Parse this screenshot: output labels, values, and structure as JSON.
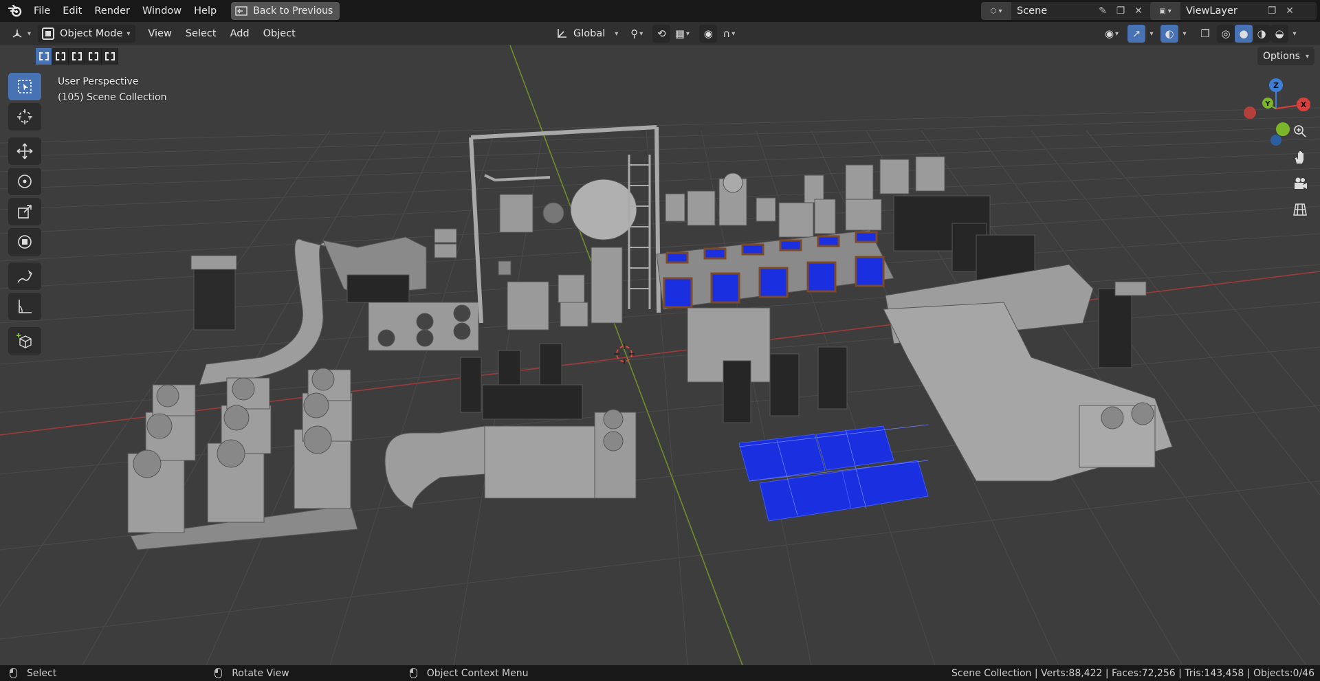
{
  "menu": {
    "items": [
      "File",
      "Edit",
      "Render",
      "Window",
      "Help"
    ],
    "back_button": "Back to Previous"
  },
  "scene": {
    "name": "Scene"
  },
  "view_layer": {
    "name": "ViewLayer"
  },
  "header": {
    "mode": "Object Mode",
    "menus": [
      "View",
      "Select",
      "Add",
      "Object"
    ],
    "transform_orientation": "Global"
  },
  "options_label": "Options",
  "viewport": {
    "perspective": "User Perspective",
    "collection": "(105) Scene Collection"
  },
  "gizmo": {
    "x": "X",
    "y": "Y",
    "z": "Z"
  },
  "status": {
    "select": "Select",
    "rotate": "Rotate View",
    "context": "Object Context Menu",
    "stats": "Scene Collection | Verts:88,422 | Faces:72,256 | Tris:143,458 | Objects:0/46"
  },
  "colors": {
    "accent": "#4772b3",
    "background": "#3d3d3d",
    "topbar": "#181818",
    "solar_panel": "#1a2fe0",
    "x_axis": "#c44",
    "y_axis": "#8c3"
  },
  "icons": [
    "blender-logo",
    "back-icon",
    "scene-icon",
    "view-layer-icon",
    "select-box-tool",
    "cursor-tool",
    "move-tool",
    "rotate-tool",
    "scale-tool",
    "transform-tool",
    "annotate-tool",
    "measure-tool",
    "add-cube-tool",
    "zoom-icon",
    "hand-icon",
    "camera-icon",
    "grid-icon"
  ]
}
